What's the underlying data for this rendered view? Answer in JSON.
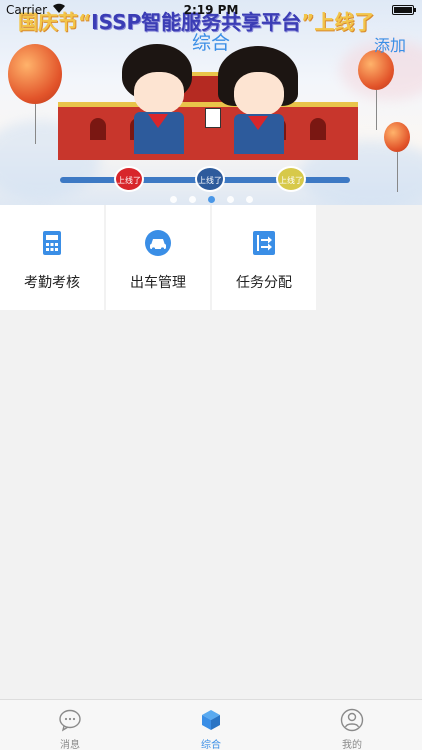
{
  "status_bar": {
    "carrier": "Carrier",
    "time": "2:19 PM"
  },
  "banner": {
    "headline_start": "国庆节“",
    "headline_mid": "ISSP智能服务共享平台",
    "headline_end": "”上线了",
    "badges": [
      "上线了",
      "上线了",
      "上线了"
    ],
    "page_count": 5,
    "active_page": 2
  },
  "nav": {
    "title": "综合",
    "add_label": "添加"
  },
  "grid": {
    "items": [
      {
        "label": "考勤考核",
        "icon": "attendance-icon"
      },
      {
        "label": "出车管理",
        "icon": "car-icon"
      },
      {
        "label": "任务分配",
        "icon": "task-assign-icon"
      }
    ]
  },
  "tabbar": {
    "tabs": [
      {
        "label": "消息",
        "icon": "message-icon"
      },
      {
        "label": "综合",
        "icon": "cube-icon"
      },
      {
        "label": "我的",
        "icon": "profile-icon"
      }
    ],
    "active_index": 1
  },
  "colors": {
    "accent": "#3a8ee6",
    "background": "#f2f2f2",
    "tab_inactive": "#8a8a8a"
  }
}
